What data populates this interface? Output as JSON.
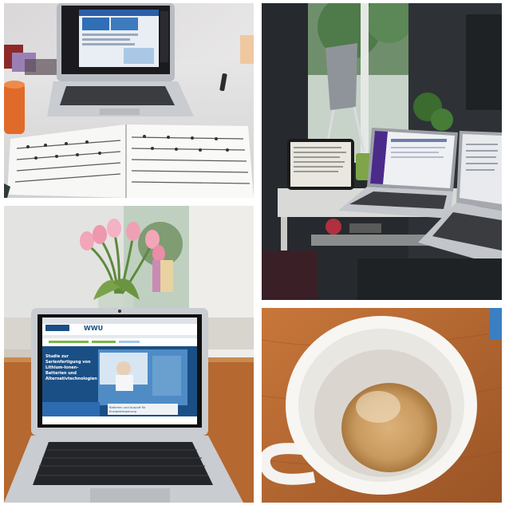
{
  "collage": {
    "panels": [
      {
        "id": "music-laptop",
        "subject": "laptop-with-video-call-and-sheet-music"
      },
      {
        "id": "window-desk",
        "subject": "tablet-and-two-laptops-on-low-table"
      },
      {
        "id": "tulips-laptop",
        "subject": "laptop-showing-university-page-with-tulips"
      },
      {
        "id": "coffee-cup",
        "subject": "nearly-empty-coffee-cup-on-wood"
      }
    ]
  },
  "screen": {
    "logo": "WWU",
    "headline_lines": [
      "Studie zur",
      "Serienfertigung von",
      "Lithium-Ionen-",
      "Batterien und",
      "Alternativtechnologien"
    ],
    "teaser_lines": [
      "Batterien und Auspuff für",
      "Energieeinsparung"
    ]
  },
  "colors": {
    "wwu_blue": "#1a4f86",
    "wwu_green": "#7ab648",
    "mac_silver": "#c9ccd0",
    "wood": "#b5682f",
    "tulip_pink": "#f2a6b8",
    "mug_orange": "#e06a2a"
  }
}
